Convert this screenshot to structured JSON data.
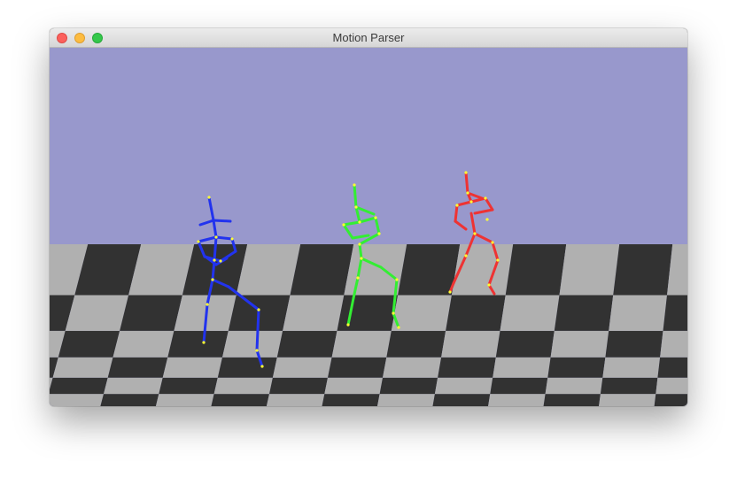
{
  "window": {
    "title": "Motion Parser"
  },
  "scene": {
    "sky_color": "#9898cc",
    "floor_light_color": "#b0b0b0",
    "floor_dark_color": "#323232",
    "joint_color": "#ffff33",
    "figures": [
      {
        "name": "figure-blue",
        "color": "#2233ee"
      },
      {
        "name": "figure-green",
        "color": "#33ee33"
      },
      {
        "name": "figure-red",
        "color": "#ee3333"
      }
    ]
  }
}
